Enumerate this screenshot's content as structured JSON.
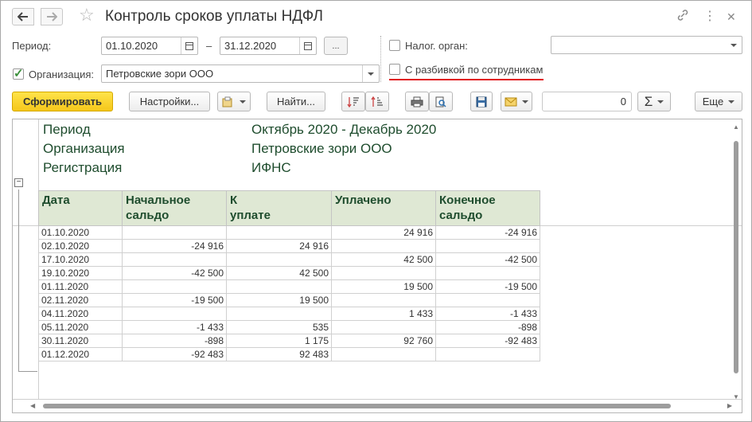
{
  "window": {
    "title": "Контроль сроков уплаты НДФЛ"
  },
  "filters": {
    "period_label": "Период:",
    "date_from": "01.10.2020",
    "dash": "–",
    "date_to": "31.12.2020",
    "ellipsis_label": "...",
    "org_label": "Организация:",
    "org_value": "Петровские зори ООО",
    "tax_authority_label": "Налог. орган:",
    "tax_authority_value": "",
    "breakdown_label": "С разбивкой по сотрудникам"
  },
  "toolbar": {
    "generate_label": "Сформировать",
    "settings_label": "Настройки...",
    "find_label": "Найти...",
    "counter_value": "0",
    "sum_symbol": "Σ",
    "more_label": "Еще"
  },
  "report": {
    "header": [
      {
        "label": "Период",
        "value": "Октябрь 2020 - Декабрь 2020"
      },
      {
        "label": "Организация",
        "value": "Петровские зори ООО"
      },
      {
        "label": "Регистрация",
        "value": "ИФНС"
      }
    ],
    "columns": [
      "Дата",
      "Начальное сальдо",
      "К уплате",
      "Уплачено",
      "Конечное сальдо"
    ],
    "rows": [
      [
        "01.10.2020",
        "",
        "",
        "24 916",
        "-24 916"
      ],
      [
        "02.10.2020",
        "-24 916",
        "24 916",
        "",
        ""
      ],
      [
        "17.10.2020",
        "",
        "",
        "42 500",
        "-42 500"
      ],
      [
        "19.10.2020",
        "-42 500",
        "42 500",
        "",
        ""
      ],
      [
        "01.11.2020",
        "",
        "",
        "19 500",
        "-19 500"
      ],
      [
        "02.11.2020",
        "-19 500",
        "19 500",
        "",
        ""
      ],
      [
        "04.11.2020",
        "",
        "",
        "1 433",
        "-1 433"
      ],
      [
        "05.11.2020",
        "-1 433",
        "535",
        "",
        "-898"
      ],
      [
        "30.11.2020",
        "-898",
        "1 175",
        "92 760",
        "-92 483"
      ],
      [
        "01.12.2020",
        "-92 483",
        "92 483",
        "",
        ""
      ]
    ]
  },
  "icons": {
    "back": "back-arrow-icon",
    "forward": "forward-arrow-icon",
    "favorite": "star-icon",
    "link": "link-icon",
    "menu": "kebab-menu-icon",
    "close": "close-icon"
  },
  "colors": {
    "accent_yellow": "#f5c71a",
    "header_green": "#1f4d2e",
    "table_header_bg": "#dfe8d4",
    "highlight_red": "#e0141a"
  }
}
